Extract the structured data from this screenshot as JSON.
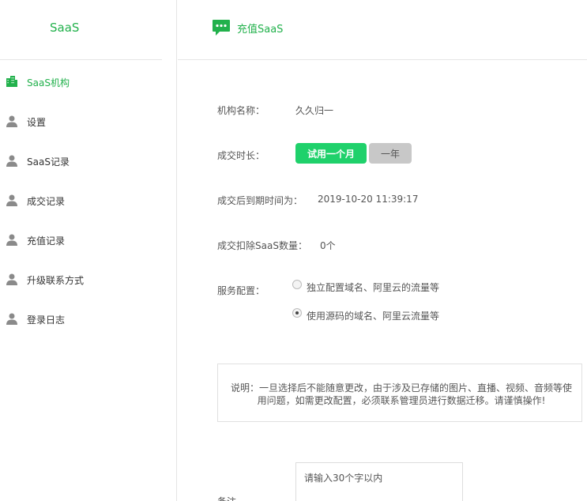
{
  "brand": {
    "title": "SaaS"
  },
  "sidebar": {
    "items": [
      {
        "label": "SaaS机构",
        "icon": "building-icon",
        "active": true
      },
      {
        "label": "设置",
        "icon": "user-icon"
      },
      {
        "label": "SaaS记录",
        "icon": "user-icon"
      },
      {
        "label": "成交记录",
        "icon": "user-icon"
      },
      {
        "label": "充值记录",
        "icon": "user-icon"
      },
      {
        "label": "升级联系方式",
        "icon": "user-icon"
      },
      {
        "label": "登录日志",
        "icon": "user-icon"
      }
    ]
  },
  "header": {
    "title": "充值SaaS",
    "icon": "chat-icon"
  },
  "form": {
    "org_name_label": "机构名称：",
    "org_name_value": "久久归一",
    "duration_label": "成交时长：",
    "duration_options": [
      "试用一个月",
      "一年"
    ],
    "duration_selected": "试用一个月",
    "expire_label": "成交后到期时间为：",
    "expire_value": "2019-10-20 11:39:17",
    "deduct_label": "成交扣除SaaS数量：",
    "deduct_value": "0个",
    "service_label": "服务配置：",
    "service_options": [
      "独立配置域名、阿里云的流量等",
      "使用源码的域名、阿里云流量等"
    ],
    "service_selected": "使用源码的域名、阿里云流量等",
    "notice": "说明：一旦选择后不能随意更改，由于涉及已存储的图片、直播、视频、音频等使用问题，如需更改配置，必须联系管理员进行数据迁移。请谨慎操作!",
    "remark_label": "备注",
    "remark_placeholder": "请输入30个字以内"
  },
  "colors": {
    "accent": "#22b14c",
    "button_primary": "#1fd16b",
    "button_gray": "#c8c8c8"
  }
}
